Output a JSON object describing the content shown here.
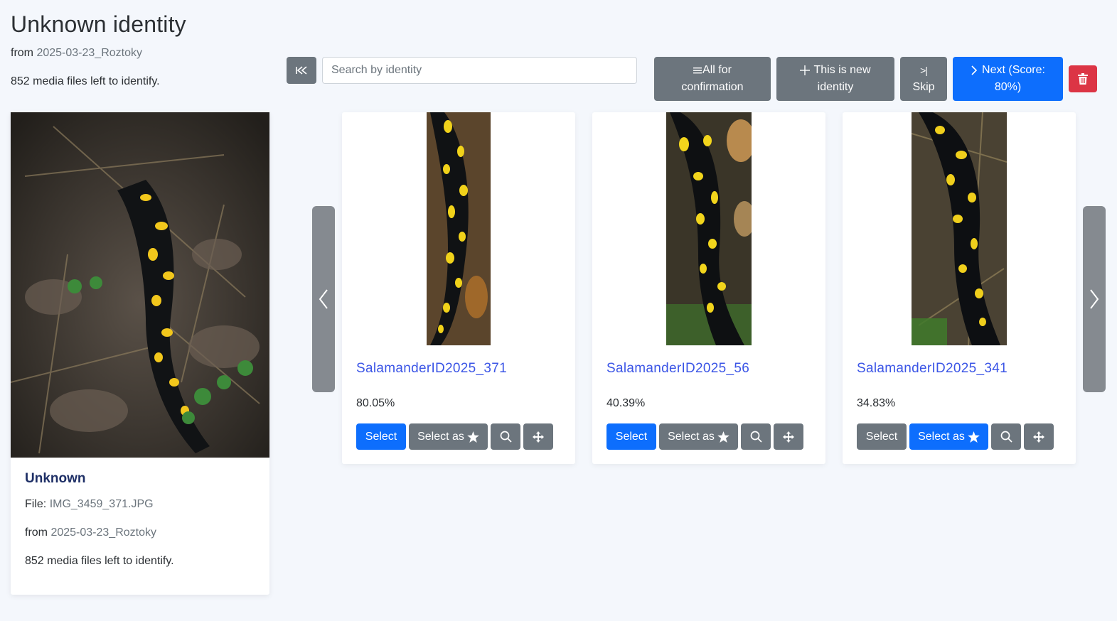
{
  "header": {
    "title": "Unknown identity",
    "from_label": "from",
    "location": "2025-03-23_Roztoky",
    "remaining": "852 media files left to identify."
  },
  "toolbar": {
    "search_placeholder": "Search by identity",
    "all_for_confirmation": "All for confirmation",
    "all_line1": "All for",
    "all_line2": "confirmation",
    "new_line1": "This is new",
    "new_line2": "identity",
    "skip_line1": ">|",
    "skip_line2": "Skip",
    "next_line1": "Next (Score:",
    "next_line2": "80%)",
    "icons": [
      "first-page-icon",
      "list-icon",
      "plus-icon",
      "skip-icon",
      "chevron-right-icon",
      "trash-icon"
    ]
  },
  "query": {
    "title": "Unknown",
    "file_label": "File:",
    "file": "IMG_3459_371.JPG",
    "from_label": "from",
    "location": "2025-03-23_Roztoky",
    "remaining": "852 media files left to identify."
  },
  "candidates": [
    {
      "name": "SalamanderID2025_371",
      "score": "80.05%",
      "select": "Select",
      "select_as": "Select as",
      "primary": "select"
    },
    {
      "name": "SalamanderID2025_56",
      "score": "40.39%",
      "select": "Select",
      "select_as": "Select as",
      "primary": "select"
    },
    {
      "name": "SalamanderID2025_341",
      "score": "34.83%",
      "select": "Select",
      "select_as": "Select as",
      "primary": "select_as"
    }
  ],
  "colors": {
    "primary": "#0d6efd",
    "secondary": "#6c757d",
    "danger": "#dc3545",
    "link": "#3b55e6",
    "title_dark": "#1e2f66"
  }
}
